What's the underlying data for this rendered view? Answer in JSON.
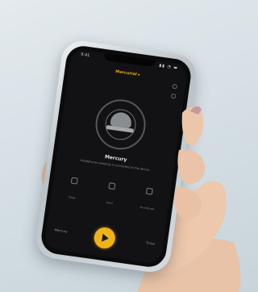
{
  "scene": {
    "subject": "hand holding smartphone",
    "background_color": "#d3dde3"
  },
  "app": {
    "status_time": "9:41",
    "status_icons": "▮▮ ◔ ▬",
    "title": "Mercurial ▸",
    "device_name": "Mercury",
    "device_subtitle": "Headphones sleeping is connected to this device",
    "actions": [
      {
        "label": "Sleep",
        "icon": "moon-icon"
      },
      {
        "label": "Alarm",
        "icon": "alarm-icon"
      },
      {
        "label": "Soundscape",
        "icon": "sound-icon"
      }
    ],
    "bottom_left": "Mercury",
    "bottom_right": "Timer",
    "accent_color": "#efb21c"
  }
}
